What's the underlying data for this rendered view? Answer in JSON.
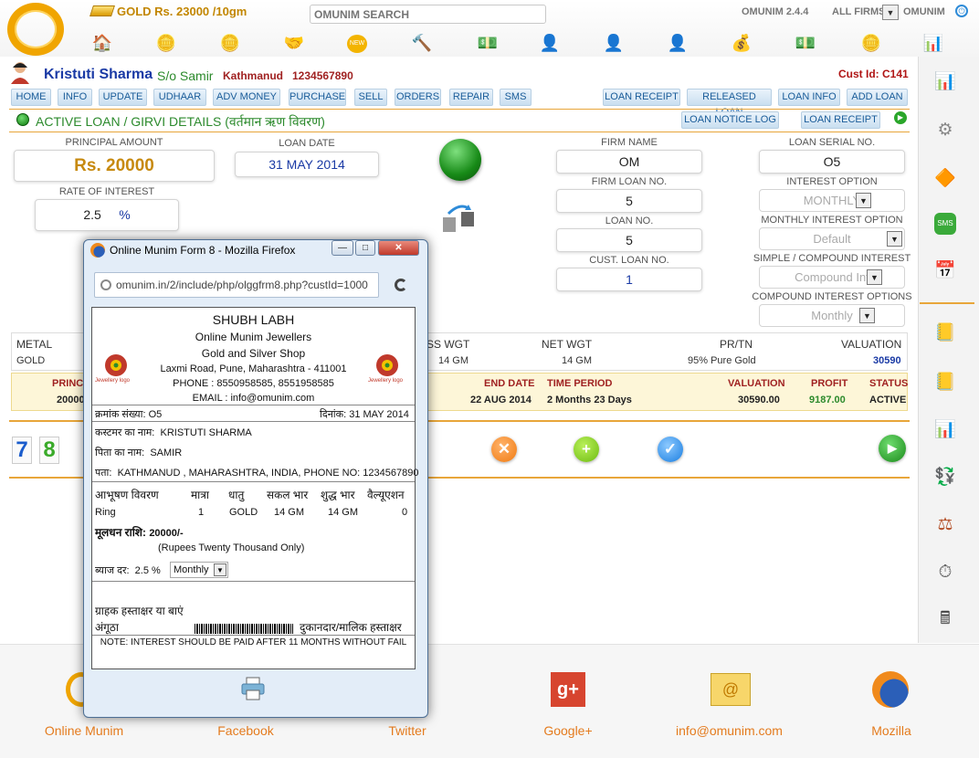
{
  "header": {
    "gold_rate": "GOLD Rs. 23000 /10gm",
    "search_placeholder": "OMUNIM SEARCH",
    "version": "OMUNIM 2.4.4",
    "all_firms": "ALL FIRMS",
    "firm_selected": "OMUNIM",
    "toolbar_icons": [
      "home-icon",
      "gold-coins-add-icon",
      "gold-coins-icon",
      "loan-handshake-icon",
      "new-badge-icon",
      "auction-hammer-icon",
      "money-spray-icon",
      "customer-icon",
      "add-customer-icon",
      "staff-icon",
      "money-bag-icon",
      "cash-icon",
      "coin-hand-icon",
      "report-chart-icon"
    ]
  },
  "customer": {
    "name": "Kristuti Sharma",
    "relation": "S/o Samir",
    "city": "Kathmanud",
    "phone": "1234567890",
    "cust_id_label": "Cust Id:",
    "cust_id": "C141"
  },
  "nav": {
    "left": [
      "HOME",
      "INFO",
      "UPDATE",
      "UDHAAR",
      "ADV MONEY",
      "PURCHASE",
      "SELL",
      "ORDERS",
      "REPAIR",
      "SMS"
    ],
    "right": [
      "LOAN RECEIPT",
      "RELEASED LOAN",
      "LOAN INFO",
      "ADD LOAN"
    ]
  },
  "section": {
    "title": "ACTIVE LOAN / GIRVI DETAILS (वर्तमान ऋण विवरण)",
    "loan_notice_log": "LOAN NOTICE LOG",
    "loan_receipt": "LOAN RECEIPT"
  },
  "loan": {
    "principal_label": "PRINCIPAL AMOUNT",
    "principal": "Rs. 20000",
    "rate_label": "RATE OF INTEREST",
    "rate": "2.5",
    "rate_unit": "%",
    "loan_date_label": "LOAN DATE",
    "loan_date": "31 MAY 2014",
    "firm_name_label": "FIRM NAME",
    "firm_name": "OM",
    "firm_loan_no_label": "FIRM LOAN NO.",
    "firm_loan_no": "5",
    "loan_no_label": "LOAN NO.",
    "loan_no": "5",
    "cust_loan_no_label": "CUST. LOAN NO.",
    "cust_loan_no": "1",
    "serial_label": "LOAN SERIAL NO.",
    "serial": "O5",
    "interest_option_label": "INTEREST OPTION",
    "interest_option": "MONTHLY",
    "monthly_option_label": "MONTHLY INTEREST OPTION",
    "monthly_option": "Default",
    "simple_compound_label": "SIMPLE / COMPOUND INTEREST",
    "simple_compound": "Compound Int",
    "compound_options_label": "COMPOUND INTEREST OPTIONS",
    "compound_option": "Monthly"
  },
  "metal_table": {
    "headers": [
      "METAL",
      "SS WGT",
      "NET WGT",
      "PR/TN",
      "VALUATION"
    ],
    "row": [
      "GOLD",
      "14 GM",
      "14 GM",
      "95% Pure Gold",
      "30590"
    ]
  },
  "summary": {
    "headers": [
      "PRINCI",
      "END DATE",
      "TIME PERIOD",
      "VALUATION",
      "PROFIT",
      "STATUS"
    ],
    "values": [
      "20000",
      "22 AUG 2014",
      "2 Months 23 Days",
      "30590.00",
      "9187.00",
      "ACTIVE"
    ]
  },
  "digits": [
    "7",
    "8"
  ],
  "footer": [
    "Online Munim",
    "Facebook",
    "Twitter",
    "Google+",
    "info@omunim.com",
    "Mozilla"
  ],
  "popup": {
    "window_title": "Online Munim Form 8 - Mozilla Firefox",
    "url": "omunim.in/2/include/php/olggfrm8.php?custId=1000",
    "doc": {
      "heading": "SHUBH LABH",
      "shop_name": "Online Munim Jewellers",
      "shop_type": "Gold and Silver Shop",
      "address": "Laxmi Road, Pune, Maharashtra - 411001",
      "phone": "PHONE : 8550958585, 8551958585",
      "email": "EMAIL : info@omunim.com",
      "logo_caption": "Jewellery logo",
      "serial_label": "क्रमांक संख्या:",
      "serial": "O5",
      "date_label": "दिनांक:",
      "date": "31 MAY 2014",
      "cust_label": "कस्टमर का नाम:",
      "cust": "KRISTUTI SHARMA",
      "father_label": "पिता का नाम:",
      "father": "SAMIR",
      "addr_label": "पता:",
      "addr": "KATHMANUD , MAHARASHTRA, INDIA, PHONE NO: 1234567890",
      "item_headers": [
        "आभूषण विवरण",
        "मात्रा",
        "धातु",
        "सकल भार",
        "शुद्ध भार",
        "वैल्यूएशन"
      ],
      "item_row": [
        "Ring",
        "1",
        "GOLD",
        "14 GM",
        "14 GM",
        "0"
      ],
      "principal_label": "मूलधन राशि:",
      "principal": "20000/-",
      "principal_words": "(Rupees Twenty Thousand Only)",
      "interest_label": "ब्याज दर:",
      "interest": "2.5 %",
      "interval": "Monthly",
      "cust_sign": "ग्राहक हस्ताक्षर या बाएं",
      "thumb": "अंगूठा",
      "owner_sign": "दुकानदार/मालिक हस्ताक्षर",
      "note": "NOTE: INTEREST SHOULD BE PAID AFTER 11 MONTHS WITHOUT FAIL"
    }
  }
}
